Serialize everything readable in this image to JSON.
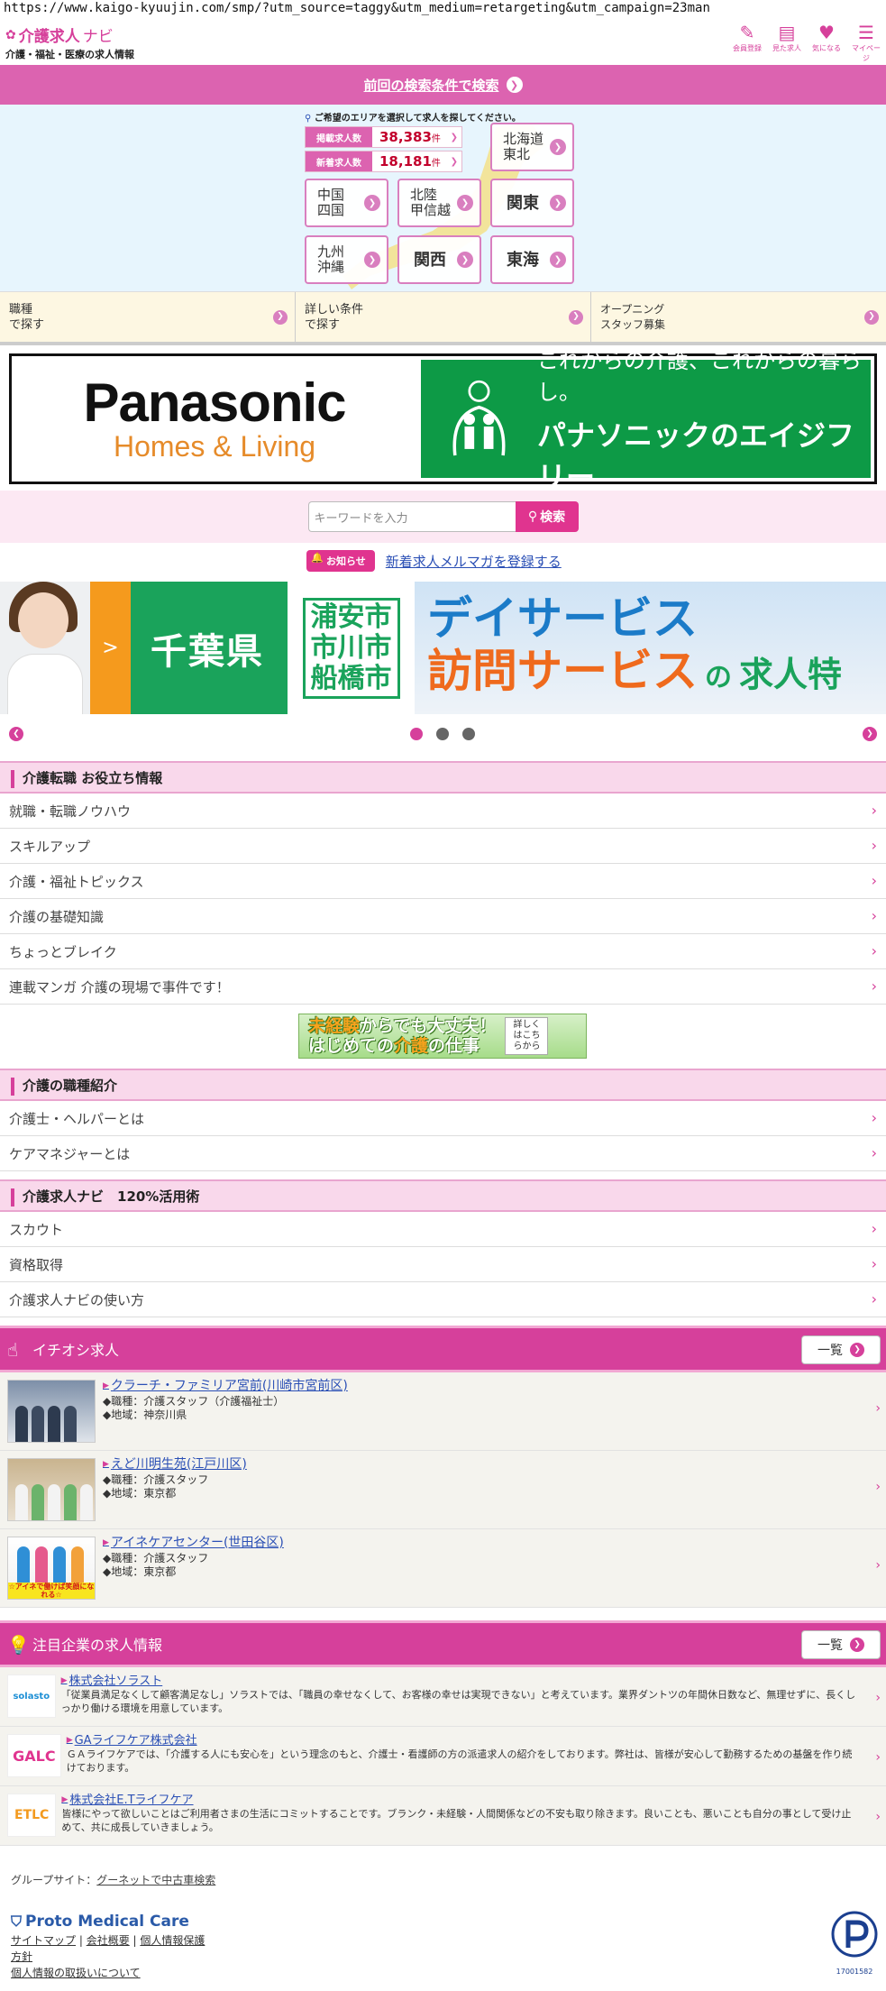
{
  "url": "https://www.kaigo-kyuujin.com/smp/?utm_source=taggy&utm_medium=retargeting&utm_campaign=23man",
  "header": {
    "logo_main": "介護求人",
    "logo_navi": "ナビ",
    "logo_sub": "介護・福祉・医療の求人情報",
    "icons": [
      {
        "icon": "pencil-icon",
        "label": "会員登録"
      },
      {
        "icon": "history-icon",
        "label": "見た求人"
      },
      {
        "icon": "heart-icon",
        "label": "気になる"
      },
      {
        "icon": "mypage-icon",
        "label": "マイページ"
      }
    ]
  },
  "prev_search": "前回の検索条件で検索",
  "area": {
    "hint": "ご希望のエリアを選択して求人を探してください。",
    "posted_label": "掲載求人数",
    "posted_count": "38,383",
    "new_label": "新着求人数",
    "new_count": "18,181",
    "unit": "件",
    "regions": [
      "北海道\n東北",
      "中国\n四国",
      "北陸\n甲信越",
      "関東",
      "九州\n沖縄",
      "関西",
      "東海"
    ]
  },
  "search_tabs": [
    "職種\nで探す",
    "詳しい条件\nで探す",
    "オープニング\nスタッフ募集"
  ],
  "banner": {
    "brand": "Panasonic",
    "sub": "Homes & Living",
    "tagline": "これからの介護、これからの暮らし。",
    "name": "パナソニックのエイジフリー"
  },
  "keyword": {
    "placeholder": "キーワードを入力",
    "button": "検索"
  },
  "notice": {
    "badge": "お知らせ",
    "link": "新着求人メルマガを登録する"
  },
  "slider": {
    "arrow": ">",
    "pref": "千葉県",
    "cities": "浦安市\n市川市\n船橋市",
    "svc1": "デイサービス",
    "svc2": "訪問サービス",
    "no": "の",
    "suffix": "求人特",
    "slide_count": 3,
    "active_slide": 1
  },
  "sections": [
    {
      "title": "介護転職 お役立ち情報",
      "items": [
        "就職・転職ノウハウ",
        "スキルアップ",
        "介護・福祉トピックス",
        "介護の基礎知識",
        "ちょっとブレイク",
        "連載マンガ 介護の現場で事件です！"
      ]
    },
    {
      "title": "介護の職種紹介",
      "items": [
        "介護士・ヘルパーとは",
        "ケアマネジャーとは"
      ]
    },
    {
      "title": "介護求人ナビ　120%活用術",
      "items": [
        "スカウト",
        "資格取得",
        "介護求人ナビの使い方"
      ]
    }
  ],
  "mini_banner": {
    "t1a": "未経験",
    "t1b": "からでも大丈夫！",
    "t2a": "はじめての",
    "t2b": "介護",
    "t2c": "の仕事",
    "side": "詳しくはこちらから"
  },
  "featured": {
    "title": "イチオシ求人",
    "more": "一覧",
    "jobs": [
      {
        "name": "クラーチ・ファミリア宮前(川崎市宮前区)",
        "role": "◆職種：介護スタッフ（介護福祉士）",
        "loc": "◆地域：神奈川県"
      },
      {
        "name": "えど川明生苑(江戸川区)",
        "role": "◆職種：介護スタッフ",
        "loc": "◆地域：東京都"
      },
      {
        "name": "アイネケアセンター(世田谷区)",
        "role": "◆職種：介護スタッフ",
        "loc": "◆地域：東京都",
        "thumb_text": "☆アイネで働けば笑顔になれる☆"
      }
    ]
  },
  "companies": {
    "title": "注目企業の求人情報",
    "more": "一覧",
    "items": [
      {
        "logo": "solasto",
        "name": "株式会社ソラスト",
        "desc": "「従業員満足なくして顧客満足なし」ソラストでは、「職員の幸せなくして、お客様の幸せは実現できない」と考えています。業界ダントツの年間休日数など、無理せずに、長くしっかり働ける環境を用意しています。"
      },
      {
        "logo": "GALC",
        "name": "GAライフケア株式会社",
        "desc": "ＧＡライフケアでは、「介護する人にも安心を」という理念のもと、介護士・看護師の方の派遣求人の紹介をしております。弊社は、皆様が安心して勤務するための基盤を作り続けております。"
      },
      {
        "logo": "ETLC",
        "name": "株式会社E.Tライフケア",
        "desc": "皆様にやって欲しいことはご利用者さまの生活にコミットすることです。ブランク・未経験・人間関係などの不安も取り除きます。良いことも、悪いことも自分の事として受け止めて、共に成長していきましょう。"
      }
    ]
  },
  "footer": {
    "group_label": "グループサイト：",
    "group_link": "グーネットで中古車検索",
    "company": "Proto Medical Care",
    "links": [
      "サイトマップ",
      "会社概要",
      "個人情報保護",
      "方針",
      "個人情報の取扱いについて"
    ],
    "privacy_num": "17001582"
  },
  "colors": {
    "accent": "#d6409b",
    "link": "#2a4fb5",
    "count": "#c2002c"
  }
}
